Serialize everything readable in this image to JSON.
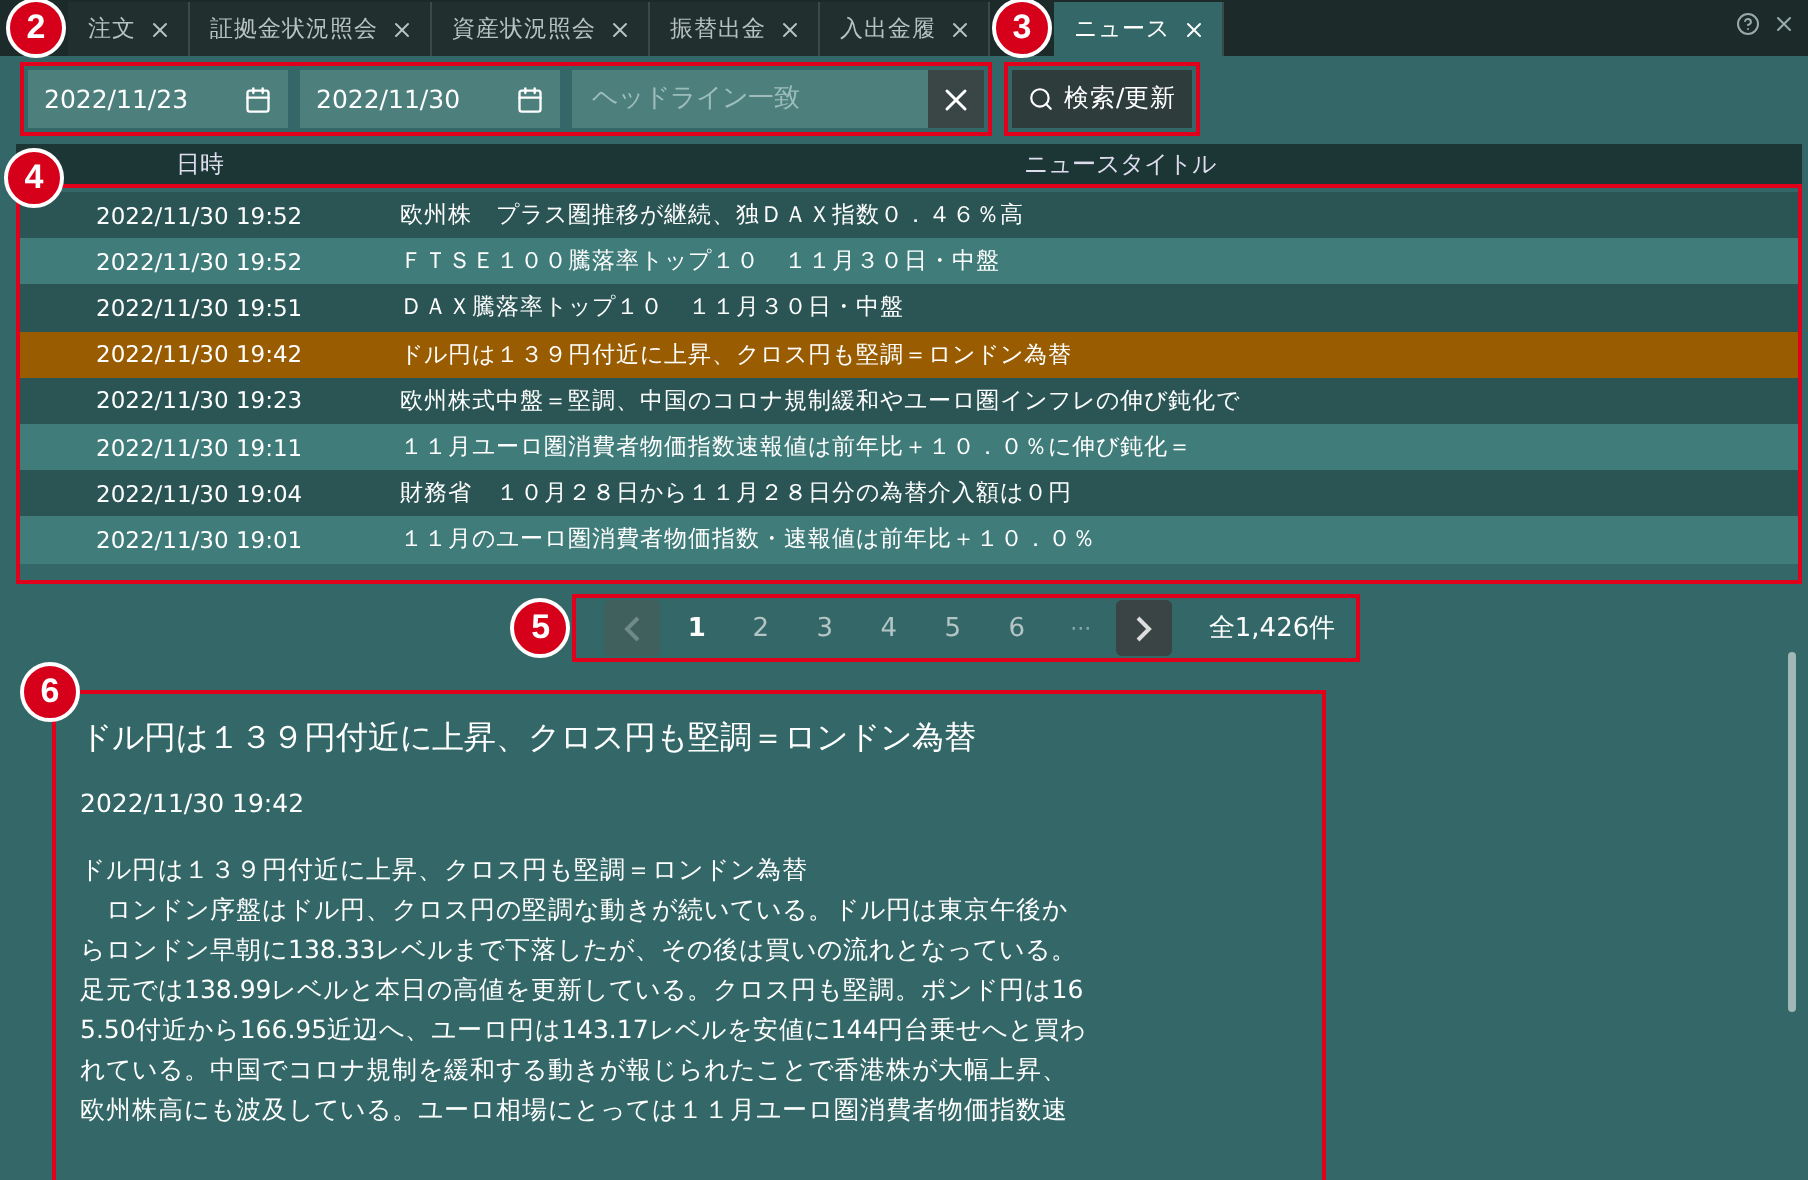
{
  "tabs": [
    {
      "label": "注文",
      "selected": false
    },
    {
      "label": "証拠金状況照会",
      "selected": false
    },
    {
      "label": "資産状況照会",
      "selected": false
    },
    {
      "label": "振替出金",
      "selected": false
    },
    {
      "label": "入出金履",
      "selected": false
    },
    {
      "label": "ニュース",
      "selected": true
    }
  ],
  "filters": {
    "date_from": "2022/11/23",
    "date_to": "2022/11/30",
    "headline": {
      "placeholder": "ヘッドライン一致"
    }
  },
  "search_button": "検索/更新",
  "table": {
    "columns": [
      "日時",
      "ニュースタイトル"
    ],
    "rows": [
      {
        "time": "2022/11/30 19:52",
        "title": "欧州株　プラス圏推移が継続、独ＤＡＸ指数０．４６％高",
        "selected": false
      },
      {
        "time": "2022/11/30 19:52",
        "title": "ＦＴＳＥ１００騰落率トップ１０　１１月３０日・中盤",
        "selected": false
      },
      {
        "time": "2022/11/30 19:51",
        "title": "ＤＡＸ騰落率トップ１０　１１月３０日・中盤",
        "selected": false
      },
      {
        "time": "2022/11/30 19:42",
        "title": "ドル円は１３９円付近に上昇、クロス円も堅調＝ロンドン為替",
        "selected": true
      },
      {
        "time": "2022/11/30 19:23",
        "title": "欧州株式中盤＝堅調、中国のコロナ規制緩和やユーロ圏インフレの伸び鈍化で",
        "selected": false
      },
      {
        "time": "2022/11/30 19:11",
        "title": "１１月ユーロ圏消費者物価指数速報値は前年比＋１０．０％に伸び鈍化＝",
        "selected": false
      },
      {
        "time": "2022/11/30 19:04",
        "title": "財務省　１０月２８日から１１月２８日分の為替介入額は０円",
        "selected": false
      },
      {
        "time": "2022/11/30 19:01",
        "title": "１１月のユーロ圏消費者物価指数・速報値は前年比＋１０．０％",
        "selected": false
      }
    ]
  },
  "pagination": {
    "prev_disabled": true,
    "pages": [
      {
        "label": "1",
        "selected": true
      },
      {
        "label": "2",
        "selected": false
      },
      {
        "label": "3",
        "selected": false
      },
      {
        "label": "4",
        "selected": false
      },
      {
        "label": "5",
        "selected": false
      },
      {
        "label": "6",
        "selected": false
      }
    ],
    "ellipsis": "···",
    "total": "全1,426件"
  },
  "article": {
    "title": "ドル円は１３９円付近に上昇、クロス円も堅調＝ロンドン為替",
    "time": "2022/11/30 19:42",
    "body_lines": [
      "ドル円は１３９円付近に上昇、クロス円も堅調＝ロンドン為替",
      "　ロンドン序盤はドル円、クロス円の堅調な動きが続いている。ドル円は東京午後か",
      "らロンドン早朝に138.33レベルまで下落したが、その後は買いの流れとなっている。",
      "足元では138.99レベルと本日の高値を更新している。クロス円も堅調。ポンド円は16",
      "5.50付近から166.95近辺へ、ユーロ円は143.17レベルを安値に144円台乗せへと買わ",
      "れている。中国でコロナ規制を緩和する動きが報じられたことで香港株が大幅上昇、",
      "欧州株高にも波及している。ユーロ相場にとっては１１月ユーロ圏消費者物価指数速"
    ]
  },
  "callouts": [
    {
      "number": "2"
    },
    {
      "number": "3"
    },
    {
      "number": "4"
    },
    {
      "number": "5"
    },
    {
      "number": "6"
    }
  ]
}
